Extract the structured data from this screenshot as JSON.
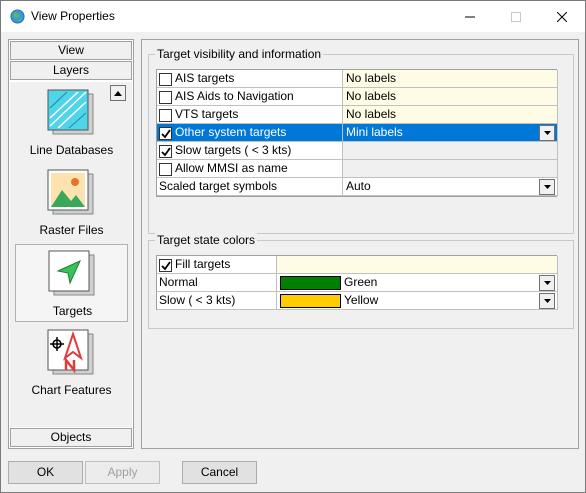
{
  "window": {
    "title": "View Properties",
    "icon": "globe-icon"
  },
  "sidebar": {
    "top_headers": [
      "View",
      "Layers"
    ],
    "items": [
      {
        "label": "Line Databases",
        "icon": "line-databases-icon"
      },
      {
        "label": "Raster Files",
        "icon": "raster-files-icon"
      },
      {
        "label": "Targets",
        "icon": "targets-icon",
        "selected": true
      },
      {
        "label": "Chart Features",
        "icon": "chart-features-icon"
      }
    ],
    "bottom_header": "Objects"
  },
  "visibility_group": {
    "title": "Target visibility and information",
    "rows": [
      {
        "label": "AIS targets",
        "checked": false,
        "value": "No labels"
      },
      {
        "label": "AIS Aids to Navigation",
        "checked": false,
        "value": "No labels"
      },
      {
        "label": "VTS targets",
        "checked": false,
        "value": "No labels"
      },
      {
        "label": "Other system targets",
        "checked": true,
        "value": "Mini labels",
        "selected": true
      },
      {
        "label": "Slow targets ( < 3 kts)",
        "checked": true,
        "value": ""
      },
      {
        "label": "Allow MMSI as name",
        "checked": false,
        "value": ""
      },
      {
        "label": "Scaled target symbols",
        "value": "Auto"
      }
    ]
  },
  "colors_group": {
    "title": "Target state colors",
    "fill_label": "Fill targets",
    "fill_checked": true,
    "rows": [
      {
        "label": "Normal",
        "color_name": "Green",
        "color": "#008000"
      },
      {
        "label": "Slow ( < 3 kts)",
        "color_name": "Yellow",
        "color": "#ffcc00"
      }
    ]
  },
  "buttons": {
    "ok": "OK",
    "apply": "Apply",
    "cancel": "Cancel"
  }
}
